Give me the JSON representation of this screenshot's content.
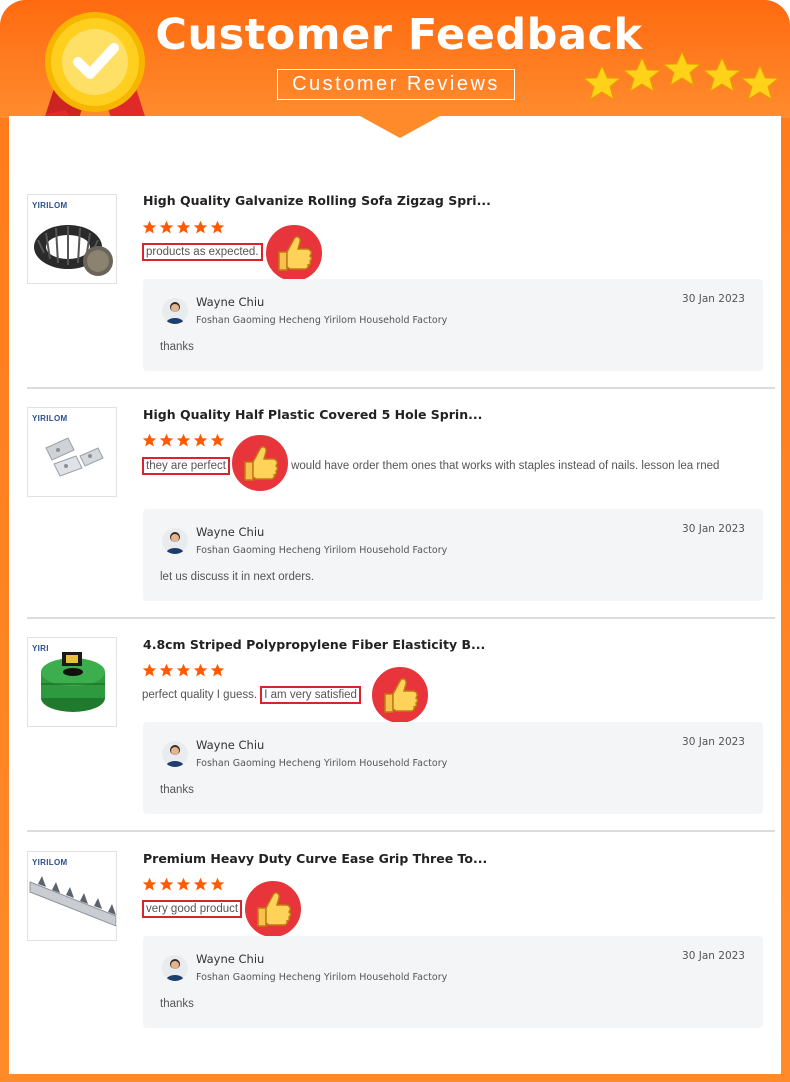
{
  "header": {
    "title": "Customer Feedback",
    "subtitle": "Customer  Reviews",
    "accent_color": "#ff7a1a",
    "badge_icon": "checkmark-medal-icon",
    "deco_icon": "five-stars-icon"
  },
  "reviews": [
    {
      "brand": "YIRILOM",
      "product_title": "High Quality Galvanize Rolling Sofa Zigzag Spri...",
      "rating": 5,
      "highlight": "products as expected.",
      "comment_rest": "",
      "reply": {
        "name": "Wayne Chiu",
        "company": "Foshan Gaoming Hecheng Yirilom Household Factory",
        "date": "30 Jan 2023",
        "text": "thanks"
      }
    },
    {
      "brand": "YIRILOM",
      "product_title": "High Quality Half Plastic Covered 5 Hole Sprin...",
      "rating": 5,
      "highlight": "they are perfect",
      "comment_rest": "would have order them ones that works with staples instead of nails. lesson lea rned",
      "reply": {
        "name": "Wayne Chiu",
        "company": "Foshan Gaoming Hecheng Yirilom Household Factory",
        "date": "30 Jan 2023",
        "text": "let us discuss it in next orders."
      }
    },
    {
      "brand": "YIRI",
      "product_title": "4.8cm Striped Polypropylene Fiber Elasticity B...",
      "rating": 5,
      "comment_prefix": "perfect quality I guess.",
      "highlight": "I am very satisfied",
      "comment_rest": "",
      "reply": {
        "name": "Wayne Chiu",
        "company": "Foshan Gaoming Hecheng Yirilom Household Factory",
        "date": "30 Jan 2023",
        "text": "thanks"
      }
    },
    {
      "brand": "YIRILOM",
      "product_title": "Premium Heavy Duty Curve Ease Grip Three To...",
      "rating": 5,
      "highlight": "very good product",
      "comment_rest": "",
      "reply": {
        "name": "Wayne Chiu",
        "company": "Foshan Gaoming Hecheng Yirilom Household Factory",
        "date": "30 Jan 2023",
        "text": "thanks"
      }
    }
  ]
}
